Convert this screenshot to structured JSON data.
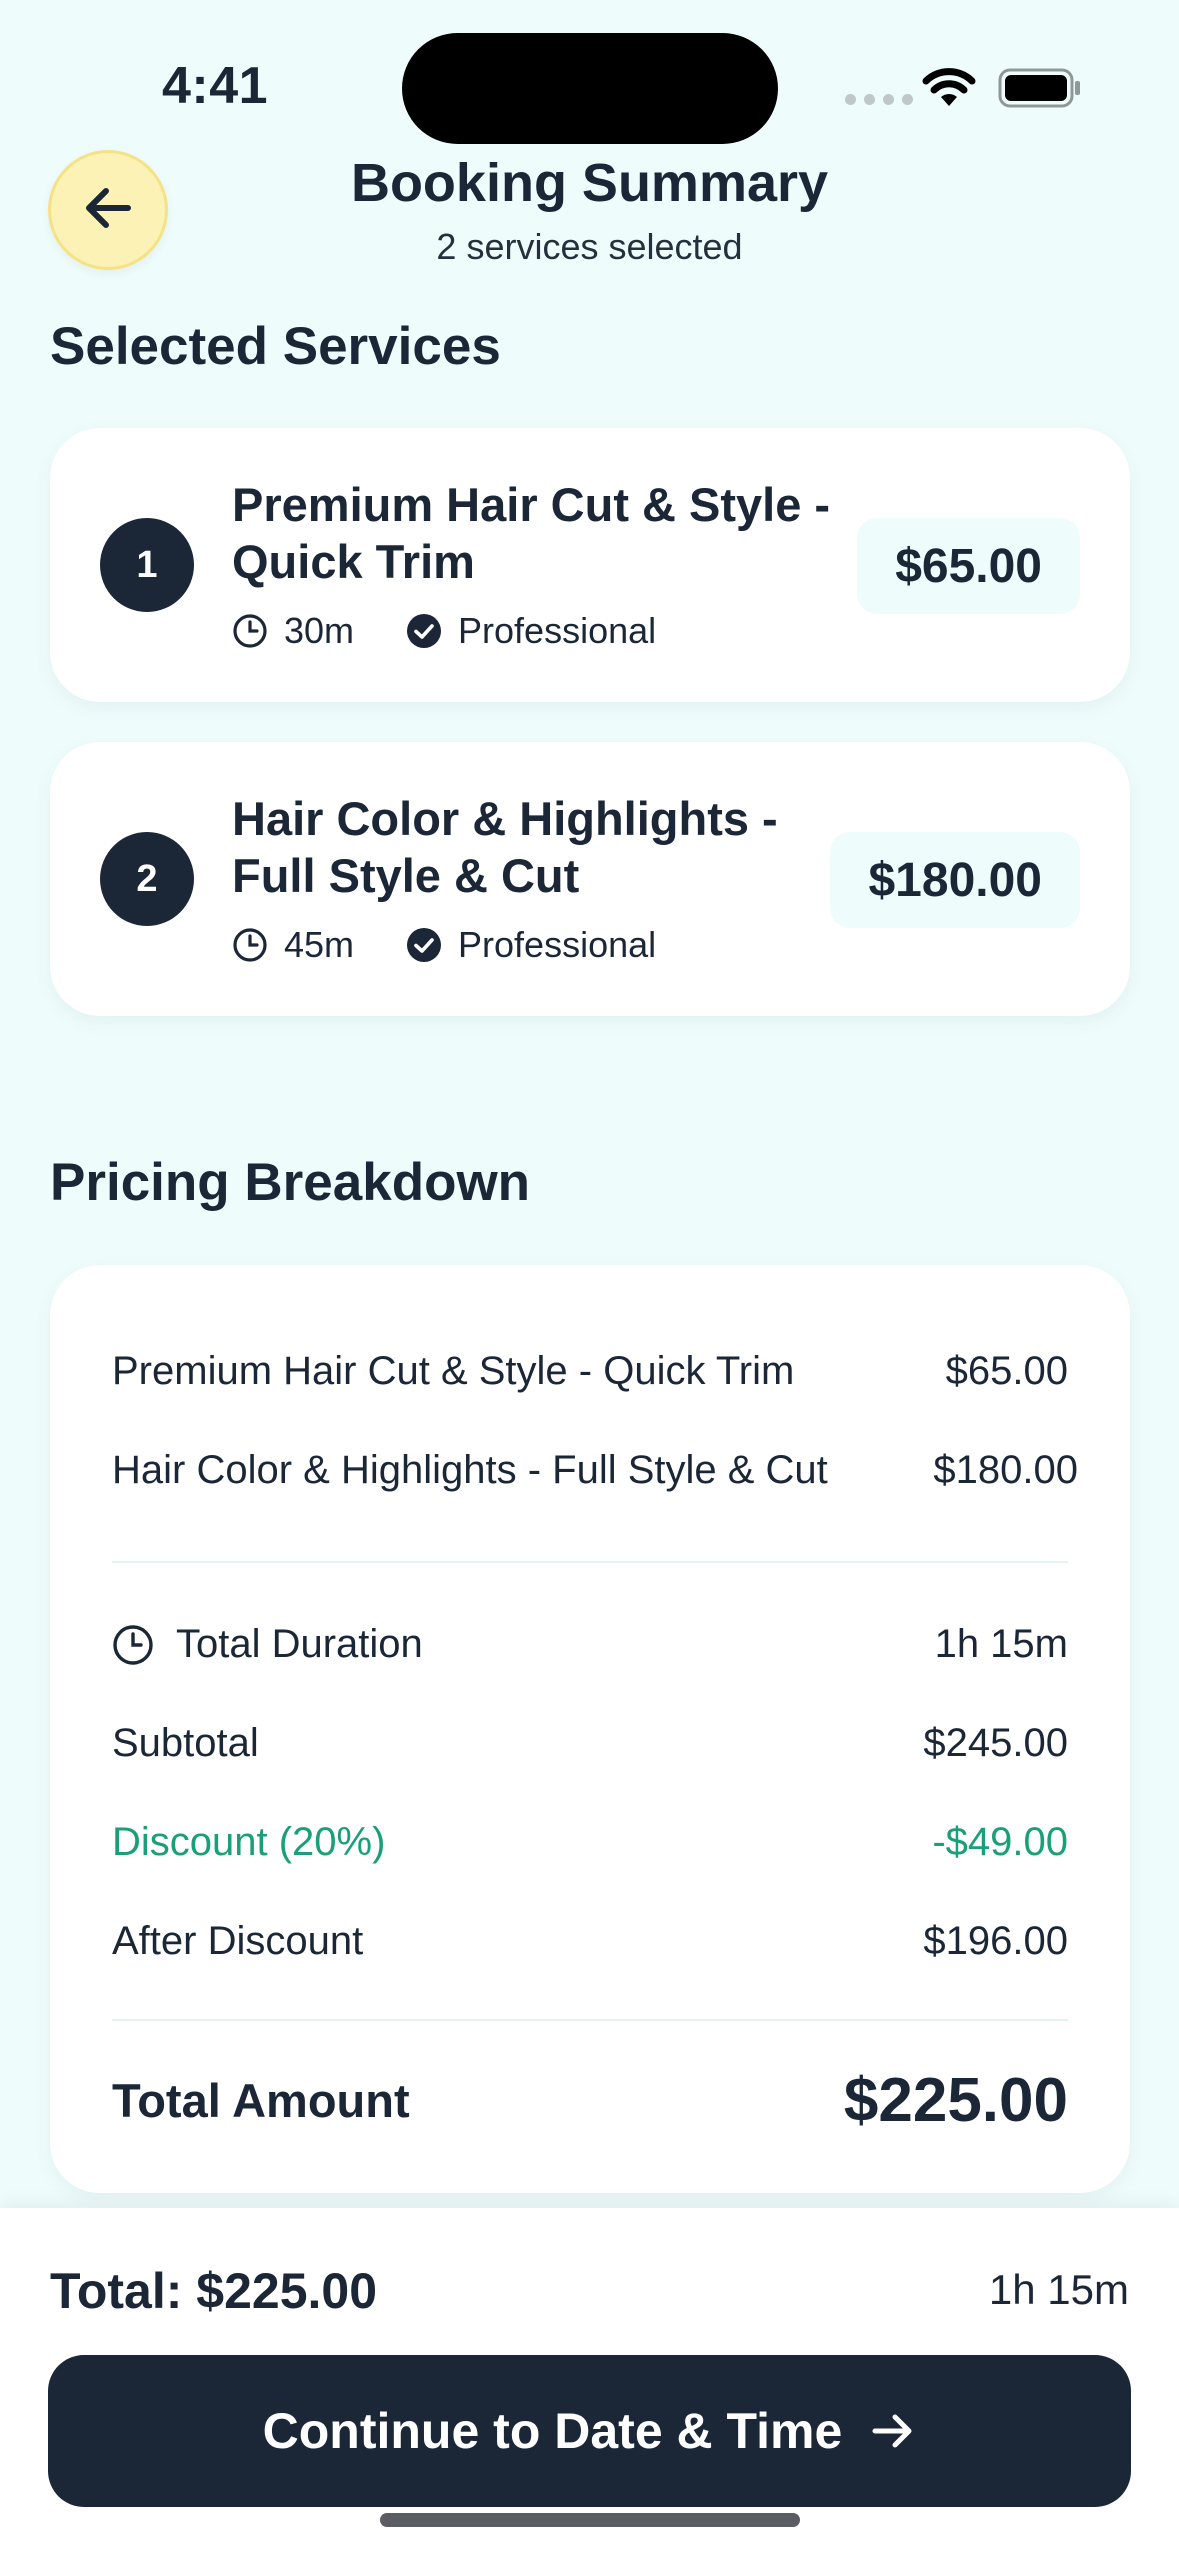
{
  "status_bar": {
    "time": "4:41"
  },
  "header": {
    "title": "Booking Summary",
    "subtitle": "2 services selected"
  },
  "selected_services": {
    "title": "Selected Services",
    "items": [
      {
        "number": "1",
        "name": "Premium Hair Cut & Style - Quick Trim",
        "duration": "30m",
        "badge": "Professional",
        "price": "$65.00"
      },
      {
        "number": "2",
        "name": "Hair Color & Highlights - Full Style & Cut",
        "duration": "45m",
        "badge": "Professional",
        "price": "$180.00"
      }
    ]
  },
  "pricing": {
    "title": "Pricing Breakdown",
    "lines": [
      {
        "label": "Premium Hair Cut & Style - Quick Trim",
        "value": "$65.00"
      },
      {
        "label": "Hair Color & Highlights - Full Style & Cut",
        "value": "$180.00"
      }
    ],
    "total_duration_label": "Total Duration",
    "total_duration_value": "1h 15m",
    "subtotal_label": "Subtotal",
    "subtotal_value": "$245.00",
    "discount_label": "Discount (20%)",
    "discount_value": "-$49.00",
    "after_discount_label": "After Discount",
    "after_discount_value": "$196.00",
    "total_label": "Total Amount",
    "total_value": "$225.00"
  },
  "bottom_bar": {
    "total_text": "Total: $225.00",
    "duration": "1h 15m",
    "continue_label": "Continue to Date & Time"
  },
  "colors": {
    "primary": "#1b2636",
    "background": "#effcfc",
    "back_button": "#fdf2b5",
    "discount": "#1aa078"
  }
}
